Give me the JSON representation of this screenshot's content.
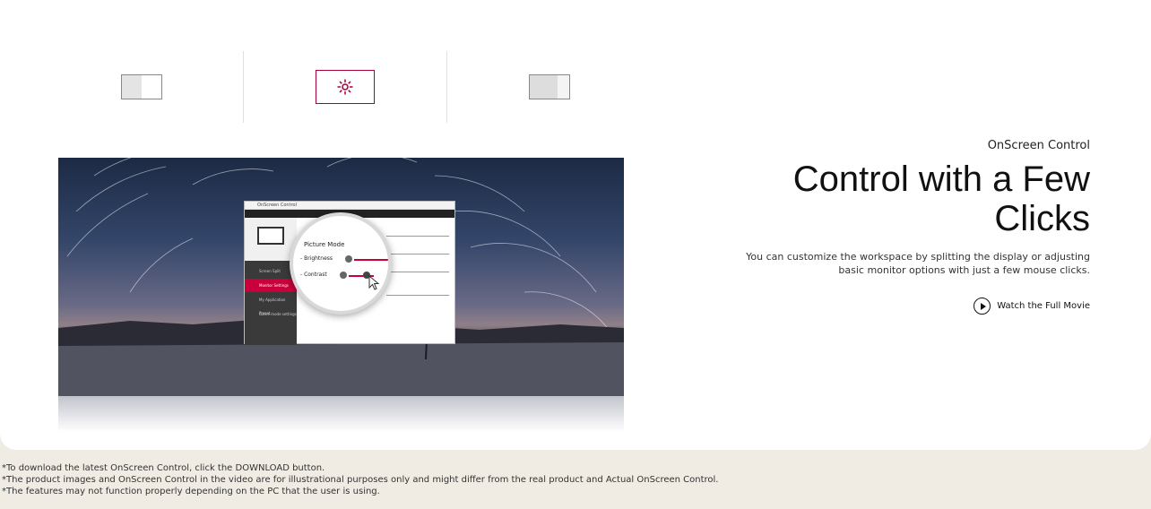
{
  "tabs": [
    {
      "name": "Screen Split",
      "icon": "split-screen-left-icon",
      "active": false
    },
    {
      "name": "Monitor Settings",
      "icon": "brightness-sun-icon",
      "active": true
    },
    {
      "name": "Split 2",
      "icon": "split-screen-right-icon",
      "active": false
    }
  ],
  "app_preview": {
    "window_title": "OnScreen Control",
    "side_items": [
      "Screen Split",
      "Monitor Settings",
      "My Application Preset",
      "Game mode settings"
    ],
    "magnifier_title": "Picture Mode",
    "brightness_label": "- Brightness",
    "contrast_label": "- Contrast"
  },
  "feature": {
    "eyebrow": "OnScreen Control",
    "headline_line1": "Control with a Few",
    "headline_line2": "Clicks",
    "description": "You can customize the workspace by splitting the display or adjusting basic monitor options with just a few mouse clicks.",
    "watch_label": "Watch the Full Movie"
  },
  "notes": [
    "*To download the latest OnScreen Control, click the DOWNLOAD button.",
    "*The product images and OnScreen Control in the video are for illustrational purposes only and might differ from the real product and Actual OnScreen Control.",
    "*The features may not function properly depending on the PC that the user is using."
  ],
  "colors": {
    "accent": "#a50034",
    "card": "#ffffff",
    "page_bg": "#f0ece4"
  }
}
